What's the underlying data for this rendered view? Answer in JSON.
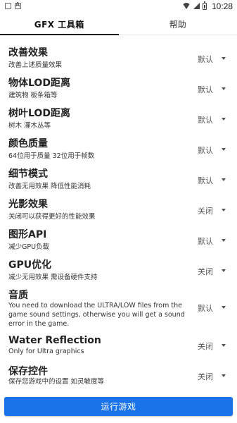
{
  "status_bar": {
    "time": "10:28"
  },
  "tabs": [
    {
      "label": "GFX 工具箱",
      "active": true
    },
    {
      "label": "帮助",
      "active": false
    }
  ],
  "settings": [
    {
      "title": "改善效果",
      "desc": "改善上述质量效果",
      "value": "默认"
    },
    {
      "title": "物体LOD距离",
      "desc": "建筑物 板条箱等",
      "value": "默认"
    },
    {
      "title": "树叶LOD距离",
      "desc": "树木 灌木丛等",
      "value": "默认"
    },
    {
      "title": "颜色质量",
      "desc": "64位用于质量 32位用于帧数",
      "value": "默认"
    },
    {
      "title": "细节模式",
      "desc": "改善无用效果 降低性能消耗",
      "value": "默认"
    },
    {
      "title": "光影效果",
      "desc": "关闭可以获得更好的性能效果",
      "value": "关闭"
    },
    {
      "title": "图形API",
      "desc": "减少GPU负载",
      "value": "默认"
    },
    {
      "title": "GPU优化",
      "desc": "减少无用效果 需设备硬件支持",
      "value": "关闭"
    },
    {
      "title": "音质",
      "desc": "You need to download the ULTRA/LOW files from the game sound settings, otherwise you will get a sound error in the game.",
      "value": "默认"
    },
    {
      "title": "Water Reflection",
      "desc": "Only for Ultra graphics",
      "value": "关闭"
    },
    {
      "title": "保存控件",
      "desc": "保存您游戏中的设置 如灵敏度等",
      "value": "关闭"
    }
  ],
  "run_button": {
    "label": "运行游戏",
    "color": "#1a73e8"
  }
}
